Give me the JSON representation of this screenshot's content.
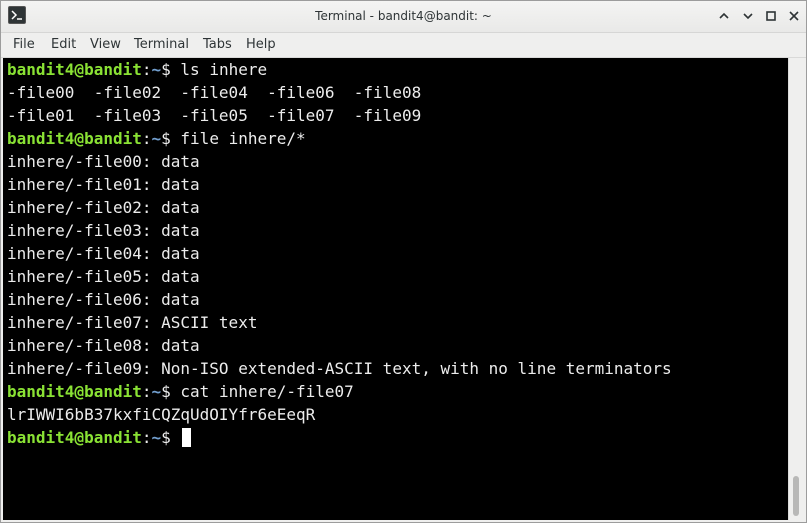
{
  "window": {
    "title": "Terminal - bandit4@bandit: ~",
    "icons": [
      "terminal-app-icon",
      "chevron-up-icon",
      "minimize-icon",
      "maximize-icon",
      "close-icon"
    ]
  },
  "menubar": {
    "items": [
      "File",
      "Edit",
      "View",
      "Terminal",
      "Tabs",
      "Help"
    ]
  },
  "terminal": {
    "prompt_user": "bandit4@bandit",
    "prompt_sep": ":",
    "prompt_path": "~",
    "prompt_sign": "$",
    "lines": [
      {
        "type": "prompt",
        "command": " ls inhere"
      },
      {
        "type": "output",
        "text": "-file00  -file02  -file04  -file06  -file08"
      },
      {
        "type": "output",
        "text": "-file01  -file03  -file05  -file07  -file09"
      },
      {
        "type": "prompt",
        "command": " file inhere/*"
      },
      {
        "type": "output",
        "text": "inhere/-file00: data"
      },
      {
        "type": "output",
        "text": "inhere/-file01: data"
      },
      {
        "type": "output",
        "text": "inhere/-file02: data"
      },
      {
        "type": "output",
        "text": "inhere/-file03: data"
      },
      {
        "type": "output",
        "text": "inhere/-file04: data"
      },
      {
        "type": "output",
        "text": "inhere/-file05: data"
      },
      {
        "type": "output",
        "text": "inhere/-file06: data"
      },
      {
        "type": "output",
        "text": "inhere/-file07: ASCII text"
      },
      {
        "type": "output",
        "text": "inhere/-file08: data"
      },
      {
        "type": "output",
        "text": "inhere/-file09: Non-ISO extended-ASCII text, with no line terminators"
      },
      {
        "type": "prompt",
        "command": " cat inhere/-file07"
      },
      {
        "type": "output",
        "text": "lrIWWI6bB37kxfiCQZqUdOIYfr6eEeqR"
      },
      {
        "type": "prompt",
        "command": " ",
        "cursor": true
      }
    ],
    "colors": {
      "background": "#000000",
      "foreground": "#ececec",
      "prompt_user": "#8ae234",
      "prompt_path": "#729fcf"
    }
  }
}
